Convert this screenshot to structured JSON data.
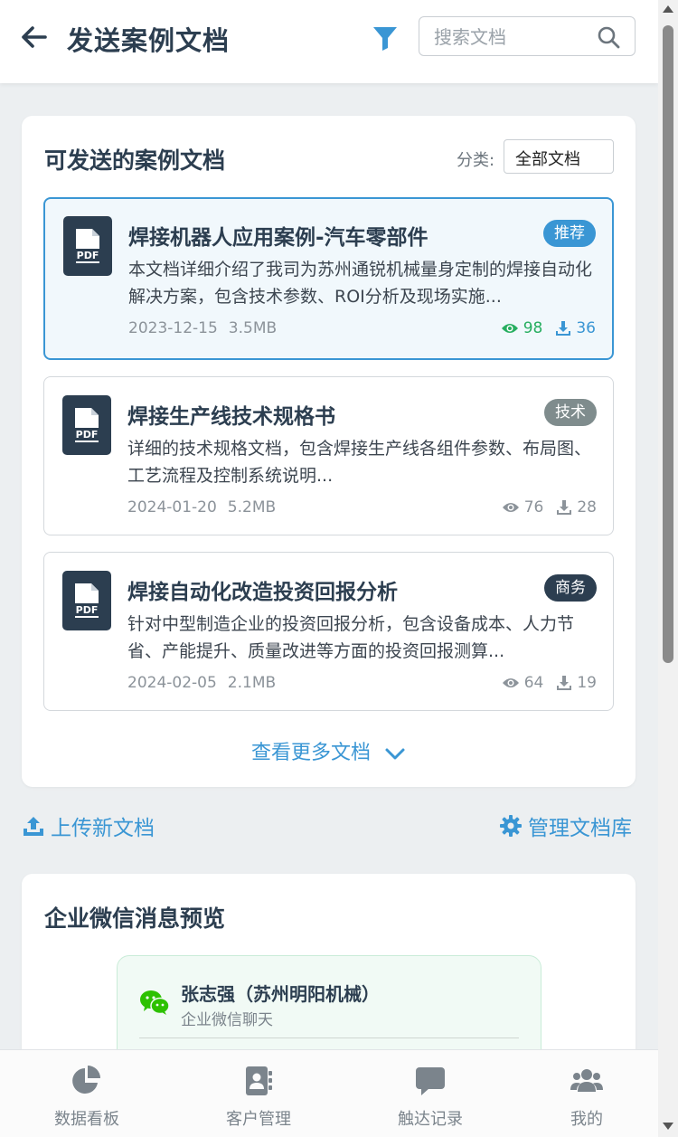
{
  "header": {
    "title": "发送案例文档",
    "search_placeholder": "搜索文档"
  },
  "docs_section": {
    "title": "可发送的案例文档",
    "category_label": "分类:",
    "category_value": "全部文档",
    "documents": [
      {
        "title": "焊接机器人应用案例-汽车零部件",
        "tag": "推荐",
        "tag_color": "#3a96d4",
        "description": "本文档详细介绍了我司为苏州通锐机械量身定制的焊接自动化解决方案，包含技术参数、ROI分析及现场实施...",
        "date": "2023-12-15",
        "size": "3.5MB",
        "views": "98",
        "downloads": "36",
        "selected": true
      },
      {
        "title": "焊接生产线技术规格书",
        "tag": "技术",
        "tag_color": "#7f8c8d",
        "description": "详细的技术规格文档，包含焊接生产线各组件参数、布局图、工艺流程及控制系统说明...",
        "date": "2024-01-20",
        "size": "5.2MB",
        "views": "76",
        "downloads": "28",
        "selected": false
      },
      {
        "title": "焊接自动化改造投资回报分析",
        "tag": "商务",
        "tag_color": "#2c3e50",
        "description": "针对中型制造企业的投资回报分析，包含设备成本、人力节省、产能提升、质量改进等方面的投资回报测算...",
        "date": "2024-02-05",
        "size": "2.1MB",
        "views": "64",
        "downloads": "19",
        "selected": false
      }
    ],
    "more_label": "查看更多文档"
  },
  "actions": {
    "upload_label": "上传新文档",
    "manage_label": "管理文档库"
  },
  "preview": {
    "title": "企业微信消息预览",
    "contact_name": "张志强（苏州明阳机械）",
    "chat_type": "企业微信聊天"
  },
  "bottom_nav": [
    {
      "label": "数据看板",
      "icon": "pie-chart-icon"
    },
    {
      "label": "客户管理",
      "icon": "address-book-icon"
    },
    {
      "label": "触达记录",
      "icon": "chat-bubble-icon"
    },
    {
      "label": "我的",
      "icon": "users-icon"
    }
  ],
  "colors": {
    "accent": "#3a96d4",
    "dark": "#2c3e50",
    "success": "#27ae60"
  }
}
